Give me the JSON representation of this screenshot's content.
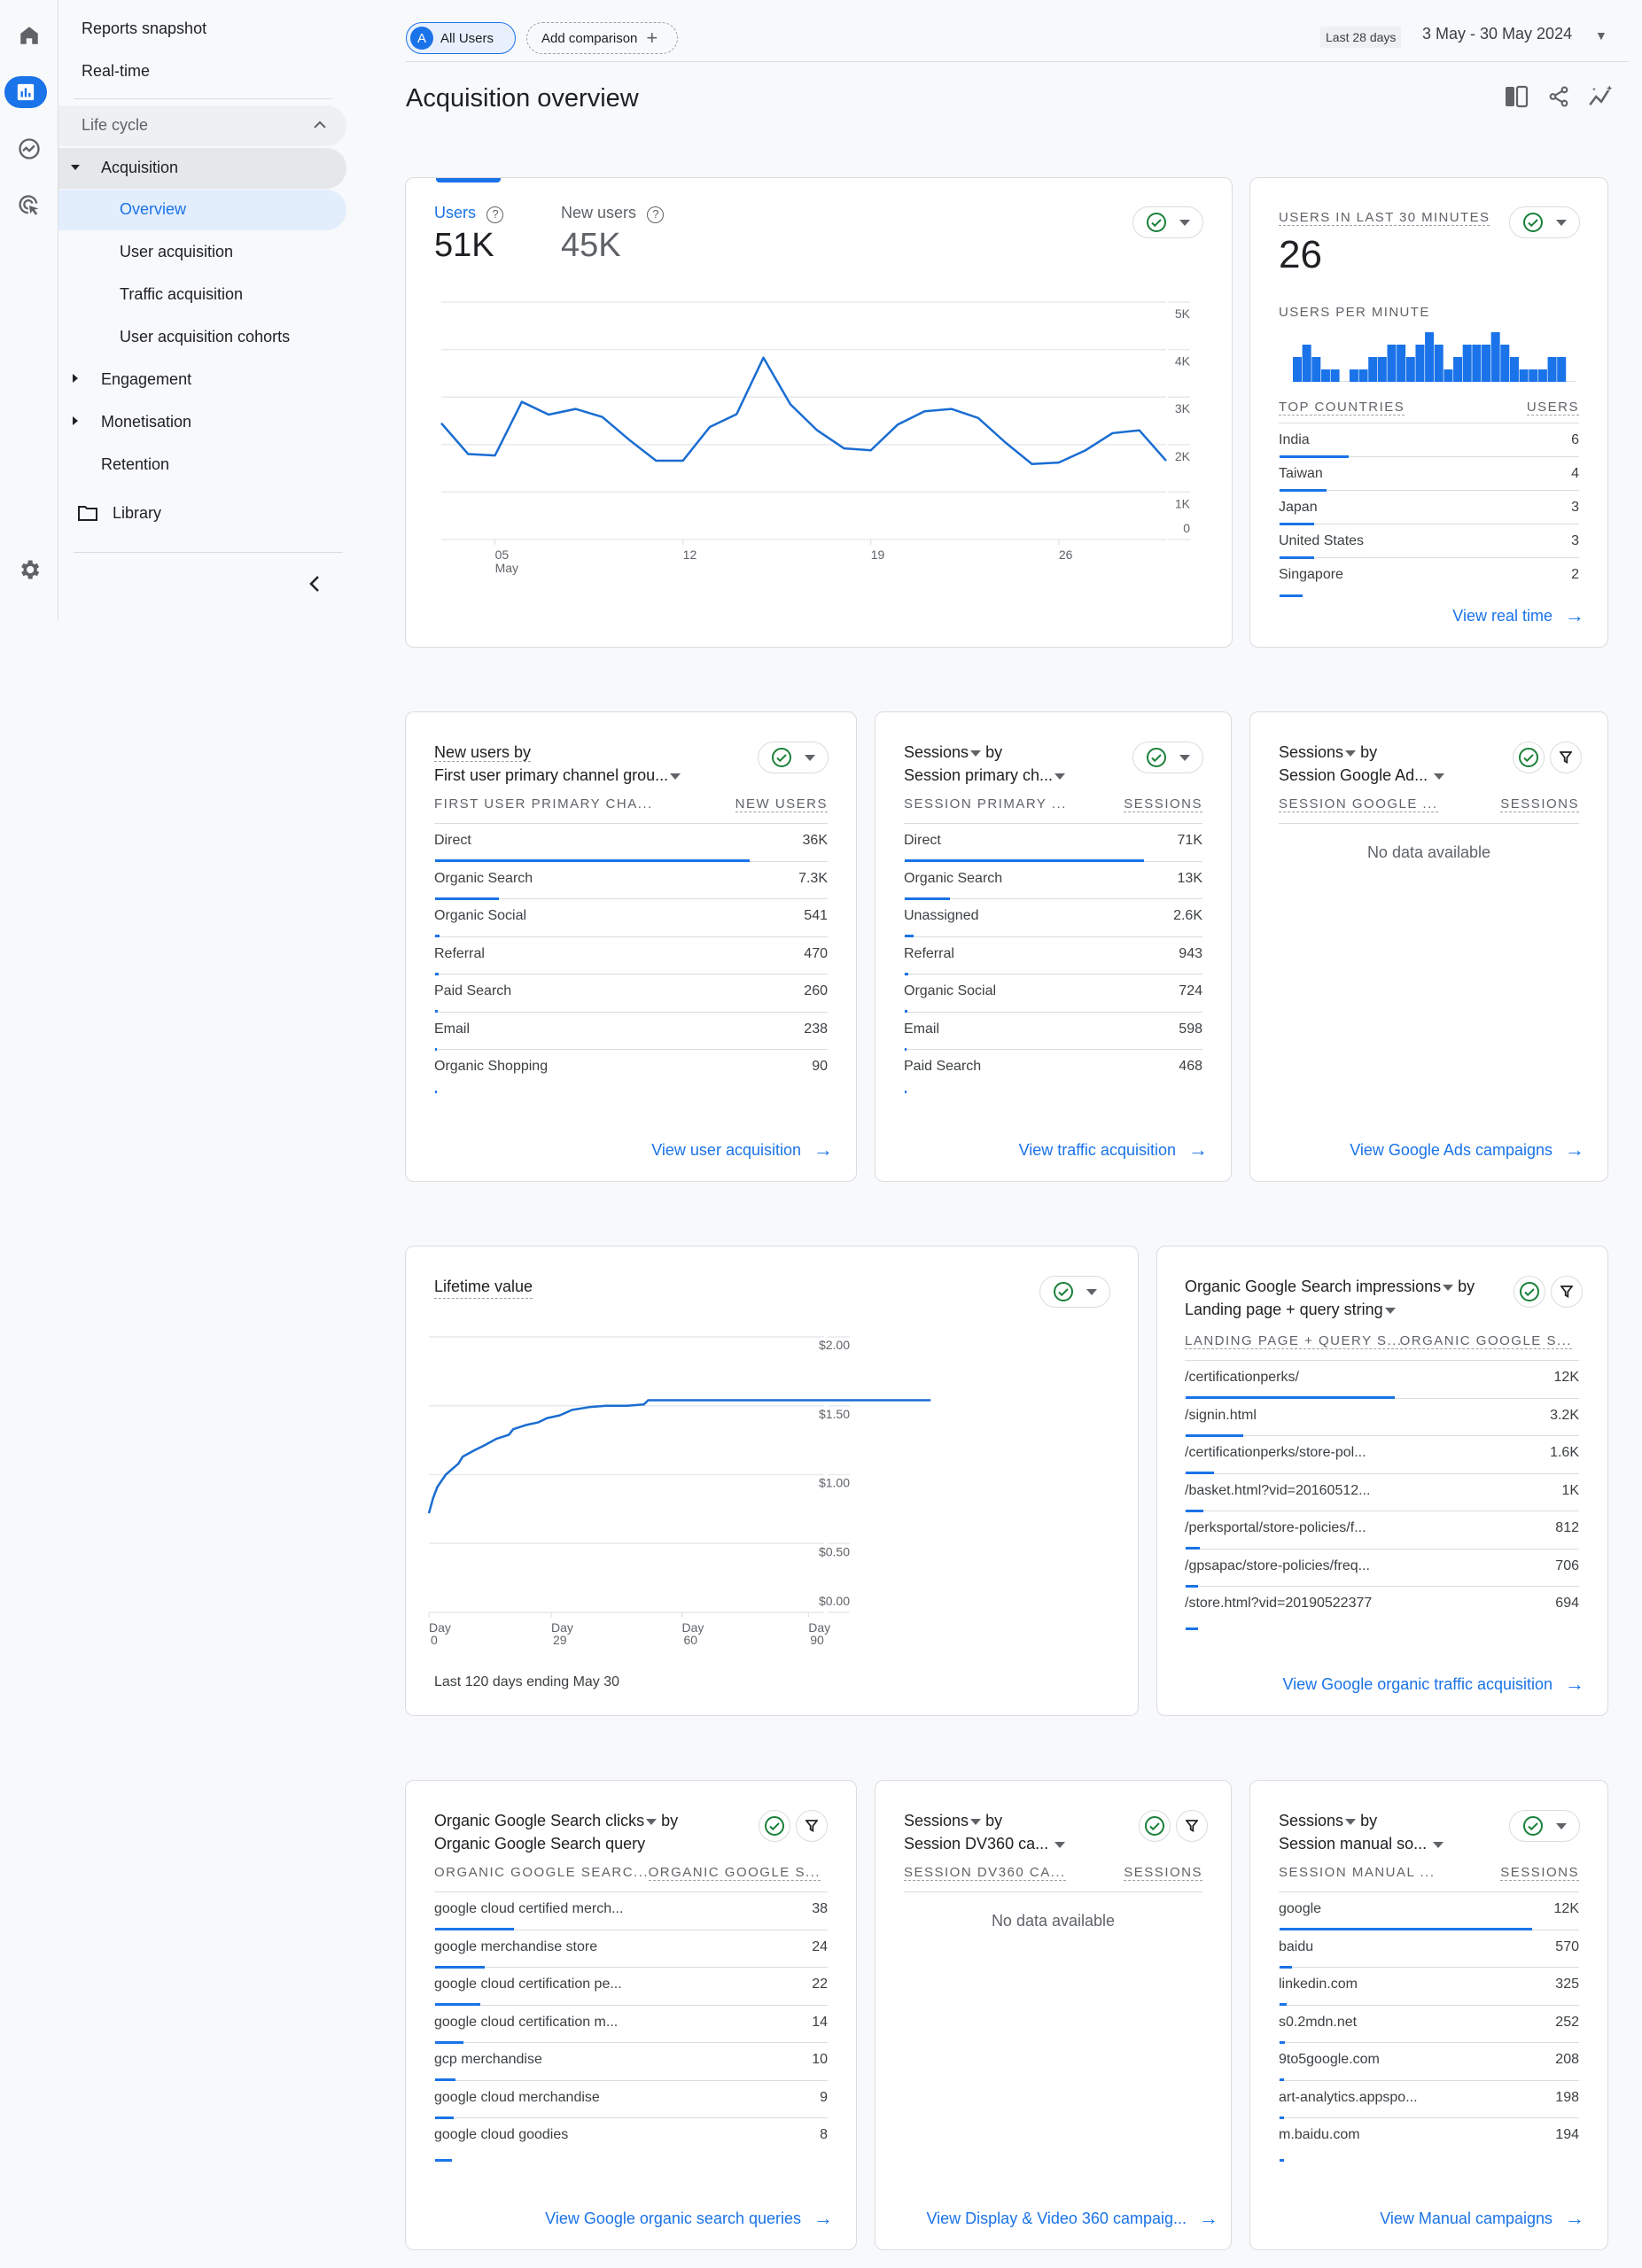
{
  "rail": {
    "icons": [
      "home-icon",
      "reports-icon",
      "explore-icon",
      "advertising-icon",
      "settings-icon"
    ]
  },
  "nav": {
    "reports_snapshot": "Reports snapshot",
    "realtime": "Real-time",
    "section": "Life cycle",
    "acquisition": "Acquisition",
    "overview": "Overview",
    "user_acquisition": "User acquisition",
    "traffic_acquisition": "Traffic acquisition",
    "user_acquisition_cohorts": "User acquisition cohorts",
    "engagement": "Engagement",
    "monetisation": "Monetisation",
    "retention": "Retention",
    "library": "Library"
  },
  "header": {
    "segment_avatar": "A",
    "segment_label": "All Users",
    "add_comparison": "Add comparison",
    "date_preset": "Last 28 days",
    "date_range": "3 May - 30 May 2024",
    "page_title": "Acquisition overview"
  },
  "colors": {
    "accent": "#1a73e8",
    "check_green": "#188038",
    "line": "#1a6dd1"
  },
  "overview_card": {
    "metrics": [
      {
        "label": "Users",
        "value": "51K",
        "active": true
      },
      {
        "label": "New users",
        "value": "45K",
        "active": false
      }
    ]
  },
  "realtime_card": {
    "title": "USERS IN LAST 30 MINUTES",
    "value": "26",
    "subtitle": "USERS PER MINUTE",
    "col1": "TOP COUNTRIES",
    "col2": "USERS",
    "rows": [
      {
        "label": "India",
        "value": "6",
        "share": 0.23
      },
      {
        "label": "Taiwan",
        "value": "4",
        "share": 0.155
      },
      {
        "label": "Japan",
        "value": "3",
        "share": 0.115
      },
      {
        "label": "United States",
        "value": "3",
        "share": 0.115
      },
      {
        "label": "Singapore",
        "value": "2",
        "share": 0.077
      }
    ],
    "link": "View real time"
  },
  "new_users_card": {
    "title_line1": "New users by",
    "title_line2": "First user primary channel grou...",
    "col1": "FIRST USER PRIMARY CHA...",
    "col2": "NEW USERS",
    "rows": [
      {
        "label": "Direct",
        "value": "36K",
        "share": 0.8
      },
      {
        "label": "Organic Search",
        "value": "7.3K",
        "share": 0.162
      },
      {
        "label": "Organic Social",
        "value": "541",
        "share": 0.012
      },
      {
        "label": "Referral",
        "value": "470",
        "share": 0.01
      },
      {
        "label": "Paid Search",
        "value": "260",
        "share": 0.006
      },
      {
        "label": "Email",
        "value": "238",
        "share": 0.005
      },
      {
        "label": "Organic Shopping",
        "value": "90",
        "share": 0.002
      }
    ],
    "link": "View user acquisition"
  },
  "sessions_channel_card": {
    "title_line1_metric": "Sessions",
    "title_line1_by": "by",
    "title_line2": "Session primary ch...",
    "col1": "SESSION PRIMARY ...",
    "col2": "SESSIONS",
    "rows": [
      {
        "label": "Direct",
        "value": "71K",
        "share": 0.8
      },
      {
        "label": "Organic Search",
        "value": "13K",
        "share": 0.15
      },
      {
        "label": "Unassigned",
        "value": "2.6K",
        "share": 0.03
      },
      {
        "label": "Referral",
        "value": "943",
        "share": 0.011
      },
      {
        "label": "Organic Social",
        "value": "724",
        "share": 0.008
      },
      {
        "label": "Email",
        "value": "598",
        "share": 0.007
      },
      {
        "label": "Paid Search",
        "value": "468",
        "share": 0.005
      }
    ],
    "link": "View traffic acquisition"
  },
  "google_ads_card": {
    "title_line1_metric": "Sessions",
    "title_line1_by": "by",
    "title_line2": "Session Google Ad...",
    "col1": "SESSION GOOGLE ...",
    "col2": "SESSIONS",
    "empty": "No data available",
    "link": "View Google Ads campaigns"
  },
  "ltv_card": {
    "title": "Lifetime value",
    "footnote": "Last 120 days ending May 30"
  },
  "organic_impressions_card": {
    "title_line1_metric": "Organic Google Search impressions",
    "title_line1_by": "by",
    "title_line2": "Landing page + query string",
    "col1": "LANDING PAGE + QUERY S...",
    "col2": "ORGANIC GOOGLE S...",
    "rows": [
      {
        "label": "/certificationperks/",
        "value": "12K",
        "share": 0.53
      },
      {
        "label": "/signin.html",
        "value": "3.2K",
        "share": 0.145
      },
      {
        "label": "/certificationperks/store-pol...",
        "value": "1.6K",
        "share": 0.072
      },
      {
        "label": "/basket.html?vid=20160512...",
        "value": "1K",
        "share": 0.046
      },
      {
        "label": "/perksportal/store-policies/f...",
        "value": "812",
        "share": 0.036
      },
      {
        "label": "/gpsapac/store-policies/freq...",
        "value": "706",
        "share": 0.032
      },
      {
        "label": "/store.html?vid=20190522377",
        "value": "694",
        "share": 0.031
      }
    ],
    "link": "View Google organic traffic acquisition"
  },
  "organic_clicks_card": {
    "title_line1_metric": "Organic Google Search clicks",
    "title_line1_by": "by",
    "title_line2": "Organic Google Search query",
    "col1": "ORGANIC GOOGLE SEARC...",
    "col2": "ORGANIC GOOGLE S...",
    "rows": [
      {
        "label": "google cloud certified merch...",
        "value": "38",
        "share": 0.2
      },
      {
        "label": "google merchandise store",
        "value": "24",
        "share": 0.125
      },
      {
        "label": "google cloud certification pe...",
        "value": "22",
        "share": 0.115
      },
      {
        "label": "google cloud certification m...",
        "value": "14",
        "share": 0.073
      },
      {
        "label": "gcp merchandise",
        "value": "10",
        "share": 0.052
      },
      {
        "label": "google cloud merchandise",
        "value": "9",
        "share": 0.047
      },
      {
        "label": "google cloud goodies",
        "value": "8",
        "share": 0.042
      }
    ],
    "link": "View Google organic search queries"
  },
  "dv360_card": {
    "title_line1_metric": "Sessions",
    "title_line1_by": "by",
    "title_line2": "Session DV360 ca...",
    "col1": "SESSION DV360 CA...",
    "col2": "SESSIONS",
    "empty": "No data available",
    "link": "View Display & Video 360 campaig..."
  },
  "manual_card": {
    "title_line1_metric": "Sessions",
    "title_line1_by": "by",
    "title_line2": "Session manual so...",
    "col1": "SESSION MANUAL ...",
    "col2": "SESSIONS",
    "rows": [
      {
        "label": "google",
        "value": "12K",
        "share": 0.84
      },
      {
        "label": "baidu",
        "value": "570",
        "share": 0.04
      },
      {
        "label": "linkedin.com",
        "value": "325",
        "share": 0.023
      },
      {
        "label": "s0.2mdn.net",
        "value": "252",
        "share": 0.018
      },
      {
        "label": "9to5google.com",
        "value": "208",
        "share": 0.015
      },
      {
        "label": "art-analytics.appspo...",
        "value": "198",
        "share": 0.014
      },
      {
        "label": "m.baidu.com",
        "value": "194",
        "share": 0.014
      }
    ],
    "link": "View Manual campaigns"
  },
  "chart_data": [
    {
      "type": "line",
      "title": "Users",
      "x": [
        "May 3",
        "May 4",
        "May 5",
        "May 6",
        "May 7",
        "May 8",
        "May 9",
        "May 10",
        "May 11",
        "May 12",
        "May 13",
        "May 14",
        "May 15",
        "May 16",
        "May 17",
        "May 18",
        "May 19",
        "May 20",
        "May 21",
        "May 22",
        "May 23",
        "May 24",
        "May 25",
        "May 26",
        "May 27",
        "May 28",
        "May 29",
        "May 30"
      ],
      "series": [
        {
          "name": "Users",
          "values": [
            2450,
            1800,
            1770,
            2900,
            2630,
            2750,
            2580,
            2100,
            1660,
            1660,
            2370,
            2640,
            3830,
            2850,
            2300,
            1920,
            1880,
            2420,
            2700,
            2750,
            2560,
            2050,
            1590,
            1620,
            1880,
            2240,
            2300,
            1660
          ]
        }
      ],
      "x_tick_labels": [
        {
          "index": 2,
          "label": "05",
          "sub": "May"
        },
        {
          "index": 9,
          "label": "12"
        },
        {
          "index": 16,
          "label": "19"
        },
        {
          "index": 23,
          "label": "26"
        }
      ],
      "y_ticks": [
        {
          "value": 0,
          "label": "0"
        },
        {
          "value": 1000,
          "label": "1K"
        },
        {
          "value": 2000,
          "label": "2K"
        },
        {
          "value": 3000,
          "label": "3K"
        },
        {
          "value": 4000,
          "label": "4K"
        },
        {
          "value": 5000,
          "label": "5K"
        }
      ],
      "ylim": [
        0,
        5000
      ],
      "grid": true,
      "y_axis_side": "right"
    },
    {
      "type": "bar",
      "title": "USERS PER MINUTE",
      "values": [
        2,
        3,
        2,
        1,
        1,
        0,
        1,
        1,
        2,
        2,
        3,
        3,
        2,
        3,
        4,
        3,
        1,
        2,
        3,
        3,
        3,
        4,
        3,
        2,
        1,
        1,
        1,
        2,
        2,
        0
      ],
      "ylim": [
        0,
        4
      ]
    },
    {
      "type": "line",
      "title": "Lifetime value",
      "xlabel": "Day",
      "series": [
        {
          "name": "Lifetime value",
          "points": [
            [
              0,
              0.72
            ],
            [
              1,
              0.83
            ],
            [
              2,
              0.91
            ],
            [
              4,
              1.0
            ],
            [
              7,
              1.08
            ],
            [
              8,
              1.13
            ],
            [
              11,
              1.18
            ],
            [
              13,
              1.21
            ],
            [
              16,
              1.26
            ],
            [
              19,
              1.29
            ],
            [
              20,
              1.33
            ],
            [
              23,
              1.36
            ],
            [
              26,
              1.38
            ],
            [
              28,
              1.41
            ],
            [
              31,
              1.43
            ],
            [
              34,
              1.47
            ],
            [
              38,
              1.49
            ],
            [
              42,
              1.5
            ],
            [
              47,
              1.5
            ],
            [
              51,
              1.51
            ],
            [
              52,
              1.54
            ],
            [
              119,
              1.54
            ]
          ]
        }
      ],
      "x_tick_labels": [
        {
          "value": 0,
          "label": "Day",
          "sub": "0"
        },
        {
          "value": 29,
          "label": "Day",
          "sub": "29"
        },
        {
          "value": 60,
          "label": "Day",
          "sub": "60"
        },
        {
          "value": 90,
          "label": "Day",
          "sub": "90"
        }
      ],
      "y_ticks": [
        {
          "value": 0,
          "label": "$0.00"
        },
        {
          "value": 0.5,
          "label": "$0.50"
        },
        {
          "value": 1,
          "label": "$1.00"
        },
        {
          "value": 1.5,
          "label": "$1.50"
        },
        {
          "value": 2,
          "label": "$2.00"
        }
      ],
      "xlim": [
        0,
        120
      ],
      "ylim": [
        0,
        2
      ],
      "grid": true,
      "y_axis_side": "right"
    }
  ]
}
